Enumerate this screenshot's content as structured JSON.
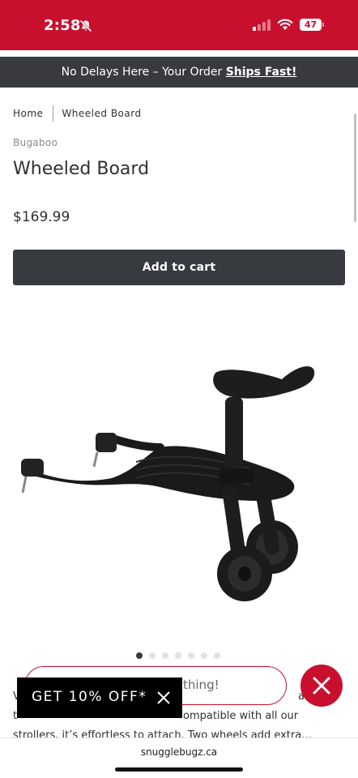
{
  "status_bar": {
    "time": "2:58",
    "battery": "47",
    "bg_color": "#c8102e"
  },
  "promo": {
    "text": "No Delays Here – Your Order ",
    "link": "Ships Fast!"
  },
  "breadcrumb": {
    "home": "Home",
    "current": "Wheeled Board"
  },
  "product": {
    "brand": "Bugaboo",
    "title": "Wheeled Board",
    "price": "$169.99",
    "add_to_cart": "Add to cart",
    "image_count": 7,
    "active_image": 1
  },
  "description": {
    "line1_start": "V",
    "line1_end": "an h",
    "line2_start": "t",
    "line2_end": "ompatible with all our",
    "line3": "strollers, it’s effortless to attach. Two wheels add extra…"
  },
  "overlay_pill": {
    "text": "thing!"
  },
  "discount_banner": {
    "text": "GET 10% OFF*"
  },
  "browser": {
    "url": "snugglebugz.ca"
  },
  "colors": {
    "accent": "#c8102e",
    "dark": "#373a3e"
  }
}
